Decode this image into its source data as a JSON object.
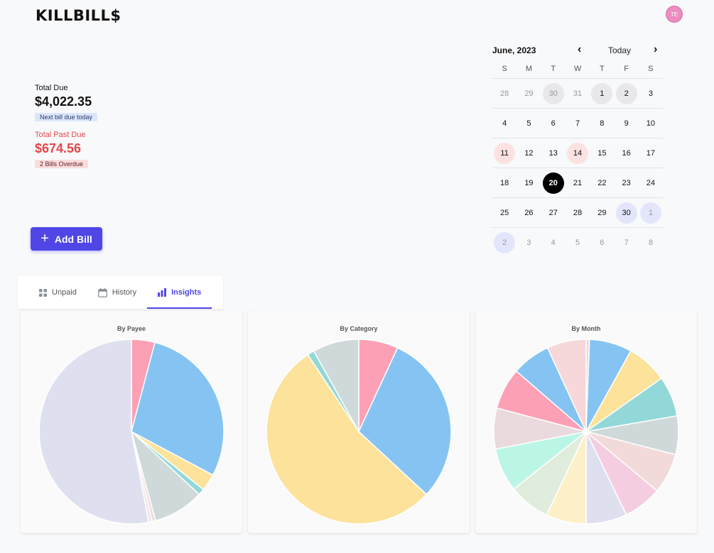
{
  "header": {
    "logo": "KILLBILL$",
    "avatar_initials": "TE"
  },
  "summary": {
    "total_due_label": "Total Due",
    "total_due_amount": "$4,022.35",
    "next_bill_badge": "Next bill due today",
    "past_due_label": "Total Past Due",
    "past_due_amount": "$674.56",
    "overdue_badge": "2 Bills Overdue"
  },
  "add_bill": {
    "label": "Add Bill"
  },
  "calendar": {
    "month_label": "June, 2023",
    "prev_icon": "chevron-left-icon",
    "today_label": "Today",
    "next_icon": "chevron-right-icon",
    "weekdays": [
      "S",
      "M",
      "T",
      "W",
      "T",
      "F",
      "S"
    ],
    "weeks": [
      [
        {
          "d": "28",
          "muted": true
        },
        {
          "d": "29",
          "muted": true
        },
        {
          "d": "30",
          "muted": true,
          "mark": "gray"
        },
        {
          "d": "31",
          "muted": true
        },
        {
          "d": "1",
          "mark": "gray"
        },
        {
          "d": "2",
          "mark": "gray"
        },
        {
          "d": "3"
        }
      ],
      [
        {
          "d": "4"
        },
        {
          "d": "5"
        },
        {
          "d": "6"
        },
        {
          "d": "7"
        },
        {
          "d": "8"
        },
        {
          "d": "9"
        },
        {
          "d": "10"
        }
      ],
      [
        {
          "d": "11",
          "mark": "pink"
        },
        {
          "d": "12"
        },
        {
          "d": "13"
        },
        {
          "d": "14",
          "mark": "pink"
        },
        {
          "d": "15"
        },
        {
          "d": "16"
        },
        {
          "d": "17"
        }
      ],
      [
        {
          "d": "18"
        },
        {
          "d": "19"
        },
        {
          "d": "20",
          "mark": "sel"
        },
        {
          "d": "21"
        },
        {
          "d": "22"
        },
        {
          "d": "23"
        },
        {
          "d": "24"
        }
      ],
      [
        {
          "d": "25"
        },
        {
          "d": "26"
        },
        {
          "d": "27"
        },
        {
          "d": "28"
        },
        {
          "d": "29"
        },
        {
          "d": "30",
          "mark": "lavender"
        },
        {
          "d": "1",
          "muted": true,
          "mark": "lavender"
        }
      ],
      [
        {
          "d": "2",
          "muted": true,
          "mark": "lavender"
        },
        {
          "d": "3",
          "muted": true
        },
        {
          "d": "4",
          "muted": true
        },
        {
          "d": "5",
          "muted": true
        },
        {
          "d": "6",
          "muted": true
        },
        {
          "d": "7",
          "muted": true
        },
        {
          "d": "8",
          "muted": true
        }
      ]
    ]
  },
  "tabs": [
    {
      "label": "Unpaid",
      "icon": "grid-icon",
      "active": false
    },
    {
      "label": "History",
      "icon": "calendar-icon",
      "active": false
    },
    {
      "label": "Insights",
      "icon": "bar-chart-icon",
      "active": true
    }
  ],
  "colors": {
    "accent": "#4f46e5",
    "past_due": "#e5484d"
  },
  "chart_data": [
    {
      "type": "pie",
      "title": "By Payee",
      "values": [
        4.1,
        28.7,
        3.0,
        1.1,
        8.9,
        0.6,
        0.6,
        53.0
      ],
      "colors": [
        "#fca1b5",
        "#85c4f2",
        "#fde29c",
        "#92d8d8",
        "#cfd9da",
        "#f3dada",
        "#ede7e8",
        "#dfe0ef"
      ]
    },
    {
      "type": "pie",
      "title": "By Category",
      "values": [
        6.9,
        30.0,
        53.8,
        1.2,
        8.1
      ],
      "colors": [
        "#fca1b5",
        "#85c4f2",
        "#fde29c",
        "#92d8d8",
        "#cfd9da"
      ]
    },
    {
      "type": "pie",
      "title": "By Month",
      "values": [
        0.6,
        7.6,
        7.3,
        7.2,
        6.9,
        7.2,
        6.9,
        7.3,
        7.2,
        7.4,
        7.8,
        7.3,
        7.4,
        6.9,
        7.0
      ],
      "colors": [
        "#f6d7da",
        "#85c4f2",
        "#fde29c",
        "#92d8d8",
        "#cfd9da",
        "#f3dada",
        "#f4cee0",
        "#dfe0ef",
        "#fdf0c8",
        "#e0ecdc",
        "#bbf5e6",
        "#ead9dd",
        "#fca1b5",
        "#85c4f2",
        "#f6d7da"
      ]
    }
  ]
}
